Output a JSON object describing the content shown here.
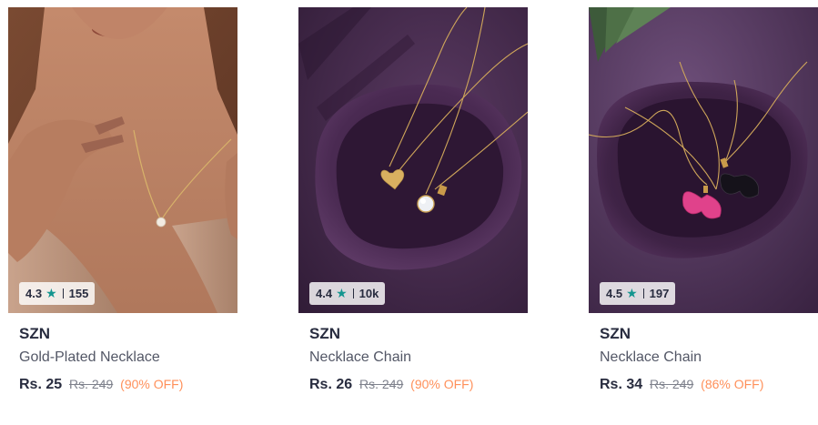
{
  "products": [
    {
      "brand": "SZN",
      "name": "Gold-Plated Necklace",
      "rating": "4.3",
      "rating_count": "155",
      "price": "Rs. 25",
      "mrp": "Rs. 249",
      "discount": "(90% OFF)",
      "image": "model-wearing-pearl-necklace"
    },
    {
      "brand": "SZN",
      "name": "Necklace Chain",
      "rating": "4.4",
      "rating_count": "10k",
      "price": "Rs. 26",
      "mrp": "Rs. 249",
      "discount": "(90% OFF)",
      "image": "heart-and-crystal-pendants-on-velvet-tray"
    },
    {
      "brand": "SZN",
      "name": "Necklace Chain",
      "rating": "4.5",
      "rating_count": "197",
      "price": "Rs. 34",
      "mrp": "Rs. 249",
      "discount": "(86% OFF)",
      "image": "butterfly-pendants-on-velvet-tray"
    }
  ],
  "colors": {
    "star": "#14958f",
    "discount": "#ff905a",
    "text_primary": "#282c3f",
    "text_secondary": "#535766",
    "mrp": "#7e818c"
  },
  "icons": {
    "star": "star-icon"
  }
}
